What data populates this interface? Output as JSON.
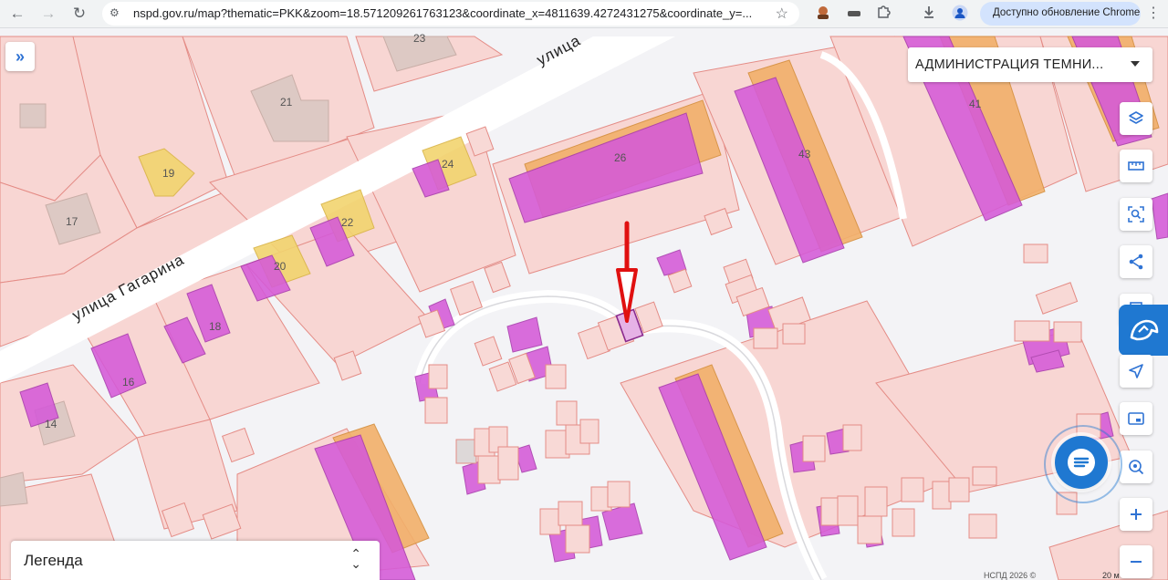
{
  "browser": {
    "url": "nspd.gov.ru/map?thematic=PKK&zoom=18.571209261763123&coordinate_x=4811639.4272431275&coordinate_y=...",
    "update_label": "Доступно обновление Chrome"
  },
  "map": {
    "streets": [
      "улица Гагарина",
      "улица"
    ],
    "house_numbers": [
      "23",
      "21",
      "19",
      "17",
      "24",
      "22",
      "20",
      "18",
      "16",
      "14",
      "26",
      "43",
      "41"
    ],
    "colors": {
      "parcel_fill": "#f8d3d0",
      "parcel_stroke": "#e78a84",
      "building_magenta": "#d05ad6",
      "building_orange": "#f0a84a",
      "building_yellow": "#f0d36a",
      "building_gray": "#d8c8c4",
      "arrow": "#e01010"
    }
  },
  "controls": {
    "expand_icon": "»",
    "layer_select_value": "АДМИНИСТРАЦИЯ ТЕМНИ...",
    "legend_label": "Легенда",
    "legend_toggle_icon": "⌃⌄",
    "attribution": "НСПД 2026 ©",
    "scale": "20 м"
  }
}
